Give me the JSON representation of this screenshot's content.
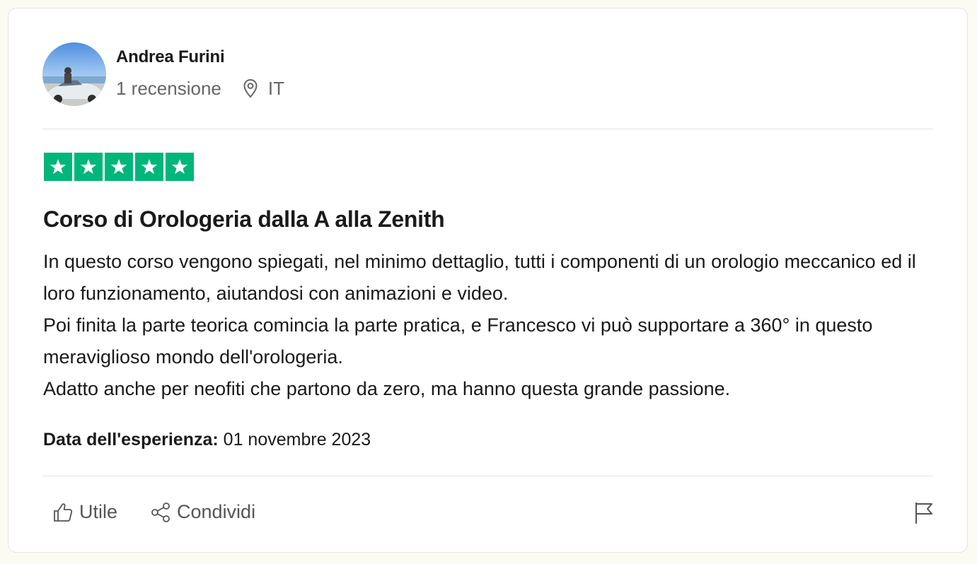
{
  "reviewer": {
    "name": "Andrea Furini",
    "reviews_count": "1 recensione",
    "country": "IT"
  },
  "rating": {
    "stars": 5,
    "max": 5,
    "color": "#00b67a"
  },
  "review": {
    "title": "Corso di Orologeria dalla A alla Zenith",
    "paragraphs": [
      "In questo corso vengono spiegati, nel minimo dettaglio, tutti i componenti di un orologio meccanico ed il loro funzionamento, aiutandosi con animazioni e video.",
      "Poi finita la parte teorica comincia la parte pratica, e Francesco vi può supportare a 360° in questo meraviglioso mondo dell'orologeria.",
      "Adatto anche per neofiti che partono da zero, ma hanno questa grande passione."
    ]
  },
  "experience": {
    "label": "Data dell'esperienza:",
    "date": "01 novembre 2023"
  },
  "actions": {
    "useful_label": "Utile",
    "share_label": "Condividi"
  },
  "icons": {
    "location": "location-pin-icon",
    "useful": "thumbs-up-icon",
    "share": "share-icon",
    "report": "flag-icon",
    "star": "star-icon"
  }
}
